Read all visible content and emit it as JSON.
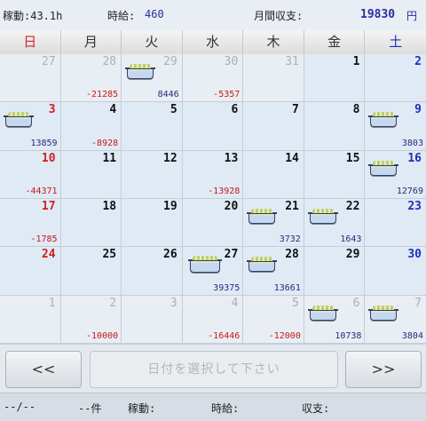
{
  "header": {
    "hours": "稼動:43.1h",
    "wage_label": "時給:",
    "wage_value": "460",
    "income_label": "月間収支:",
    "income_value": "19830",
    "currency": "円"
  },
  "weekdays": [
    "日",
    "月",
    "火",
    "水",
    "木",
    "金",
    "土"
  ],
  "weeks": [
    [
      {
        "day": "27",
        "other": true,
        "amount": ""
      },
      {
        "day": "28",
        "other": true,
        "amount": "-21285"
      },
      {
        "day": "29",
        "other": true,
        "amount": "8446",
        "icon": "bento-icon"
      },
      {
        "day": "30",
        "other": true,
        "amount": "-5357"
      },
      {
        "day": "31",
        "other": true,
        "amount": ""
      },
      {
        "day": "1",
        "amount": ""
      },
      {
        "day": "2",
        "amount": ""
      }
    ],
    [
      {
        "day": "3",
        "amount": "13859",
        "icon": "bento-icon"
      },
      {
        "day": "4",
        "amount": "-8928"
      },
      {
        "day": "5",
        "amount": ""
      },
      {
        "day": "6",
        "amount": ""
      },
      {
        "day": "7",
        "amount": ""
      },
      {
        "day": "8",
        "amount": ""
      },
      {
        "day": "9",
        "amount": "3803",
        "icon": "bento-icon"
      }
    ],
    [
      {
        "day": "10",
        "amount": "-44371"
      },
      {
        "day": "11",
        "amount": ""
      },
      {
        "day": "12",
        "amount": ""
      },
      {
        "day": "13",
        "amount": "-13928"
      },
      {
        "day": "14",
        "amount": ""
      },
      {
        "day": "15",
        "amount": ""
      },
      {
        "day": "16",
        "amount": "12769",
        "icon": "bento-icon"
      }
    ],
    [
      {
        "day": "17",
        "amount": "-1785"
      },
      {
        "day": "18",
        "amount": ""
      },
      {
        "day": "19",
        "amount": ""
      },
      {
        "day": "20",
        "amount": ""
      },
      {
        "day": "21",
        "amount": "3732",
        "icon": "bento-icon"
      },
      {
        "day": "22",
        "amount": "1643",
        "icon": "bento-icon"
      },
      {
        "day": "23",
        "amount": ""
      }
    ],
    [
      {
        "day": "24",
        "amount": ""
      },
      {
        "day": "25",
        "amount": ""
      },
      {
        "day": "26",
        "amount": ""
      },
      {
        "day": "27",
        "amount": "39375",
        "icon": "bento-big-icon"
      },
      {
        "day": "28",
        "amount": "13661",
        "icon": "bento-icon"
      },
      {
        "day": "29",
        "amount": ""
      },
      {
        "day": "30",
        "amount": ""
      }
    ],
    [
      {
        "day": "1",
        "other": true,
        "amount": ""
      },
      {
        "day": "2",
        "other": true,
        "amount": "-10000"
      },
      {
        "day": "3",
        "other": true,
        "amount": ""
      },
      {
        "day": "4",
        "other": true,
        "amount": "-16446"
      },
      {
        "day": "5",
        "other": true,
        "amount": "-12000"
      },
      {
        "day": "6",
        "other": true,
        "amount": "10738",
        "icon": "bento-icon"
      },
      {
        "day": "7",
        "other": true,
        "amount": "3804",
        "icon": "bento-icon"
      }
    ]
  ],
  "controls": {
    "prev_label": "<<",
    "next_label": ">>",
    "date_placeholder": "日付を選択して下さい"
  },
  "footer": {
    "date": "--/--",
    "count": "--件",
    "hours_label": "稼動:",
    "wage_label": "時給:",
    "income_label": "収支:"
  },
  "colors": {
    "sunday": "#d02020",
    "saturday": "#2030b8",
    "negative": "#c81818",
    "positive": "#2a2a7a"
  }
}
